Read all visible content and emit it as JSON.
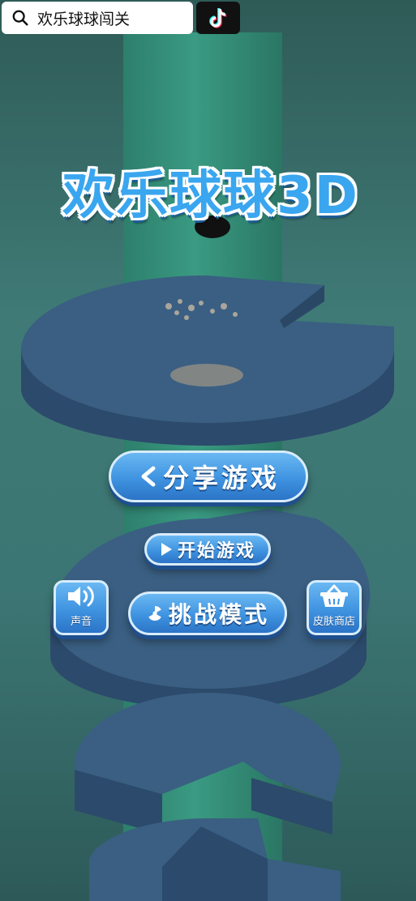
{
  "search": {
    "query": "欢乐球球闯关"
  },
  "game": {
    "title": "欢乐球球3D"
  },
  "menu": {
    "share_label": "分享游戏",
    "start_label": "开始游戏",
    "challenge_label": "挑战模式",
    "sound_label": "声音",
    "shop_label": "皮肤商店"
  },
  "colors": {
    "background": "#3f7a76",
    "tower": "#2f8a72",
    "platform_top": "#3a5f82",
    "platform_side": "#2c4a6b",
    "button": "#3f93e0",
    "title": "#3aa6ef"
  },
  "icons": {
    "search": "search-icon",
    "tiktok": "tiktok-logo-icon",
    "share": "share-icon",
    "play": "play-icon",
    "challenge": "radiation-icon",
    "sound": "speaker-icon",
    "shop": "basket-icon"
  }
}
